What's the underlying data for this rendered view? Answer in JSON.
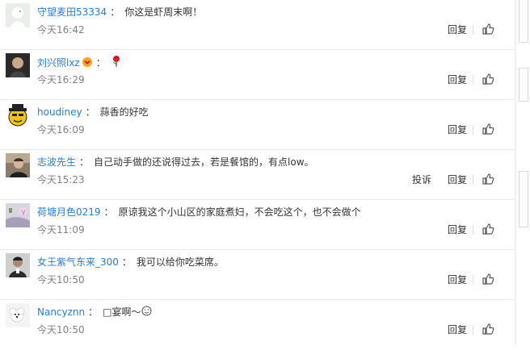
{
  "comments": [
    {
      "username": "守望麦田53334",
      "text": "你这是虾周末啊！",
      "time": "今天16:42",
      "reply": "回复"
    },
    {
      "username": "刘兴照lxz",
      "text": "",
      "time": "今天16:29",
      "reply": "回复",
      "badge_icon": "crown-heart-icon",
      "content_icon": "rose-icon"
    },
    {
      "username": "houdiney",
      "text": "蒜香的好吃",
      "time": "今天16:09",
      "reply": "回复"
    },
    {
      "username": "志波先生",
      "text": "自己动手做的还说得过去，若是餐馆的，有点low。",
      "time": "今天15:23",
      "reply": "回复",
      "report": "投诉"
    },
    {
      "username": "荷塘月色0219",
      "text": "原谅我这个小山区的家庭煮妇，不会吃这个，也不会做个",
      "time": "今天11:09",
      "reply": "回复"
    },
    {
      "username": "女王紫气东来_300",
      "text": "我可以给你吃菜席。",
      "time": "今天10:50",
      "reply": "回复"
    },
    {
      "username": "Nancyznn",
      "text": "□宴啊～",
      "time": "今天10:50",
      "reply": "回复",
      "content_icon": "smile-icon"
    }
  ],
  "colors": {
    "username": "#2b7bd0",
    "text": "#333333",
    "time": "#808080",
    "separator": "#e9e9e9"
  }
}
